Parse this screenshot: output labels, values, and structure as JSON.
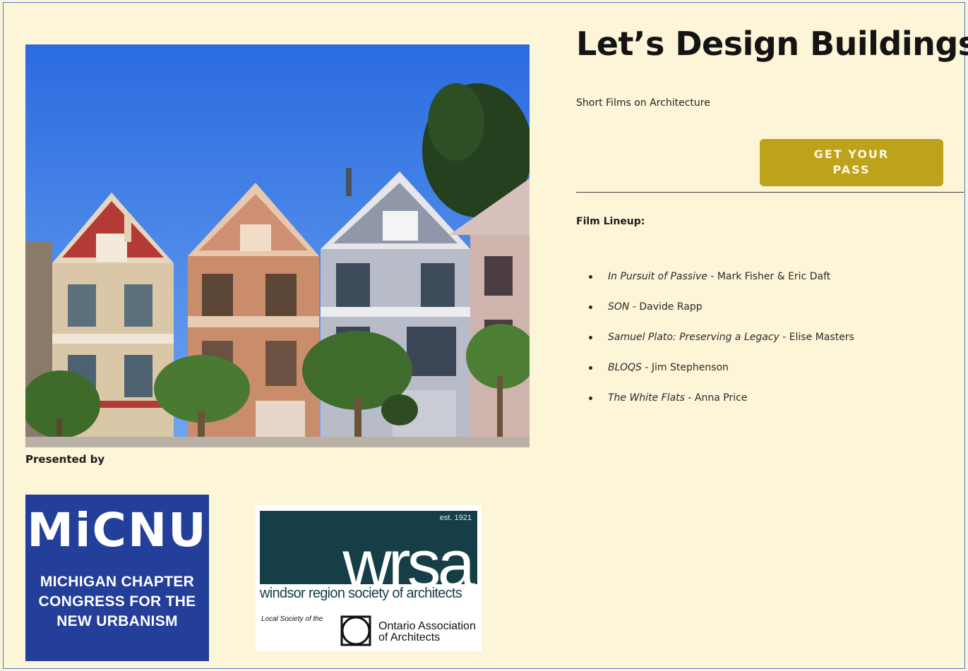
{
  "header": {
    "title": "Let’s Design Buildings",
    "subtitle": "Short Films on Architecture",
    "pass_button_line1": "GET YOUR",
    "pass_button_line2": "PASS"
  },
  "lineup": {
    "heading": "Film Lineup:",
    "films": [
      {
        "title": "In Pursuit of Passive",
        "sep": " - ",
        "credit": "Mark Fisher &  Eric Daft"
      },
      {
        "title": "SON",
        "sep": " - ",
        "credit": "Davide Rapp"
      },
      {
        "title": "Samuel Plato: Preserving a Legacy",
        "sep": " - ",
        "credit": "Elise Masters"
      },
      {
        "title": "BLOQS",
        "sep": " - ",
        "credit": "Jim Stephenson"
      },
      {
        "title": "The White Flats",
        "sep": " - ",
        "credit": "Anna Price"
      }
    ]
  },
  "presented": {
    "label": "Presented by"
  },
  "micnu_logo": {
    "acronym": "MiCNU",
    "line1": "MICHIGAN CHAPTER",
    "line2": "CONGRESS FOR THE",
    "line3": "NEW URBANISM"
  },
  "wrsa_logo": {
    "est": "est. 1921",
    "mark": "wrsa",
    "name": "windsor region society of architects",
    "local": "Local Society of the",
    "oaa_line1": "Ontario Association",
    "oaa_line2": "of Architects"
  },
  "colors": {
    "page_bg": "#fdf5d8",
    "button": "#bda31c",
    "micnu_blue": "#243f9a",
    "wrsa_teal": "#163e46"
  }
}
